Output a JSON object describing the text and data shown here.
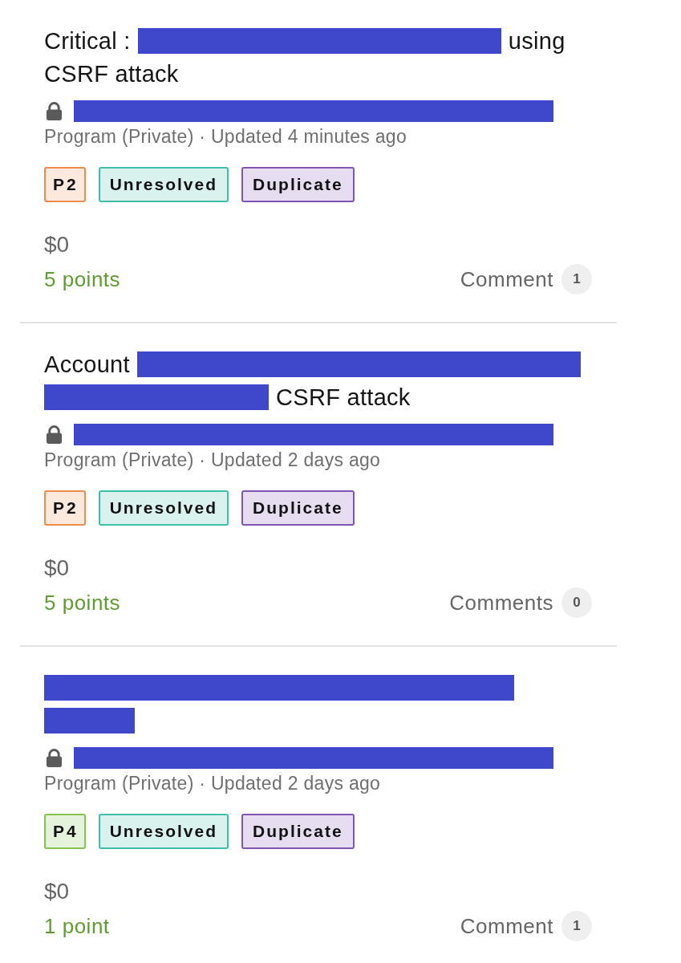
{
  "reports": [
    {
      "title_lines": [
        [
          {
            "kind": "text",
            "text": "Critical :"
          },
          {
            "kind": "redaction"
          },
          {
            "kind": "text",
            "text": "using"
          }
        ],
        [
          {
            "kind": "text",
            "text": "CSRF attack"
          }
        ]
      ],
      "program_redacted": true,
      "meta": "Program (Private) · Updated 4 minutes ago",
      "badges": [
        {
          "kind": "severity",
          "text": "P2",
          "color": "#ee8c4e"
        },
        {
          "kind": "state",
          "text": "Unresolved",
          "color": "#3fbfa9"
        },
        {
          "kind": "state",
          "text": "Duplicate",
          "color": "#8155b3"
        }
      ],
      "amount": "$0",
      "points": "5 points",
      "comments_label": "Comment",
      "comments_count": "1"
    },
    {
      "title_lines": [
        [
          {
            "kind": "text",
            "text": "Account"
          },
          {
            "kind": "redaction"
          }
        ],
        [
          {
            "kind": "redaction"
          },
          {
            "kind": "text",
            "text": "CSRF attack"
          }
        ]
      ],
      "program_redacted": true,
      "meta": "Program (Private) · Updated 2 days ago",
      "badges": [
        {
          "kind": "severity",
          "text": "P2",
          "color": "#ee8c4e"
        },
        {
          "kind": "state",
          "text": "Unresolved",
          "color": "#3fbfa9"
        },
        {
          "kind": "state",
          "text": "Duplicate",
          "color": "#8155b3"
        }
      ],
      "amount": "$0",
      "points": "5 points",
      "comments_label": "Comments",
      "comments_count": "0"
    },
    {
      "title_lines": [
        [
          {
            "kind": "redaction"
          }
        ],
        [
          {
            "kind": "redaction"
          }
        ]
      ],
      "program_redacted": true,
      "meta": "Program (Private) · Updated 2 days ago",
      "badges": [
        {
          "kind": "severity",
          "text": "P4",
          "color": "#84c34f"
        },
        {
          "kind": "state",
          "text": "Unresolved",
          "color": "#3fbfa9"
        },
        {
          "kind": "state",
          "text": "Duplicate",
          "color": "#8155b3"
        }
      ],
      "amount": "$0",
      "points": "1 point",
      "comments_label": "Comment",
      "comments_count": "1"
    }
  ]
}
